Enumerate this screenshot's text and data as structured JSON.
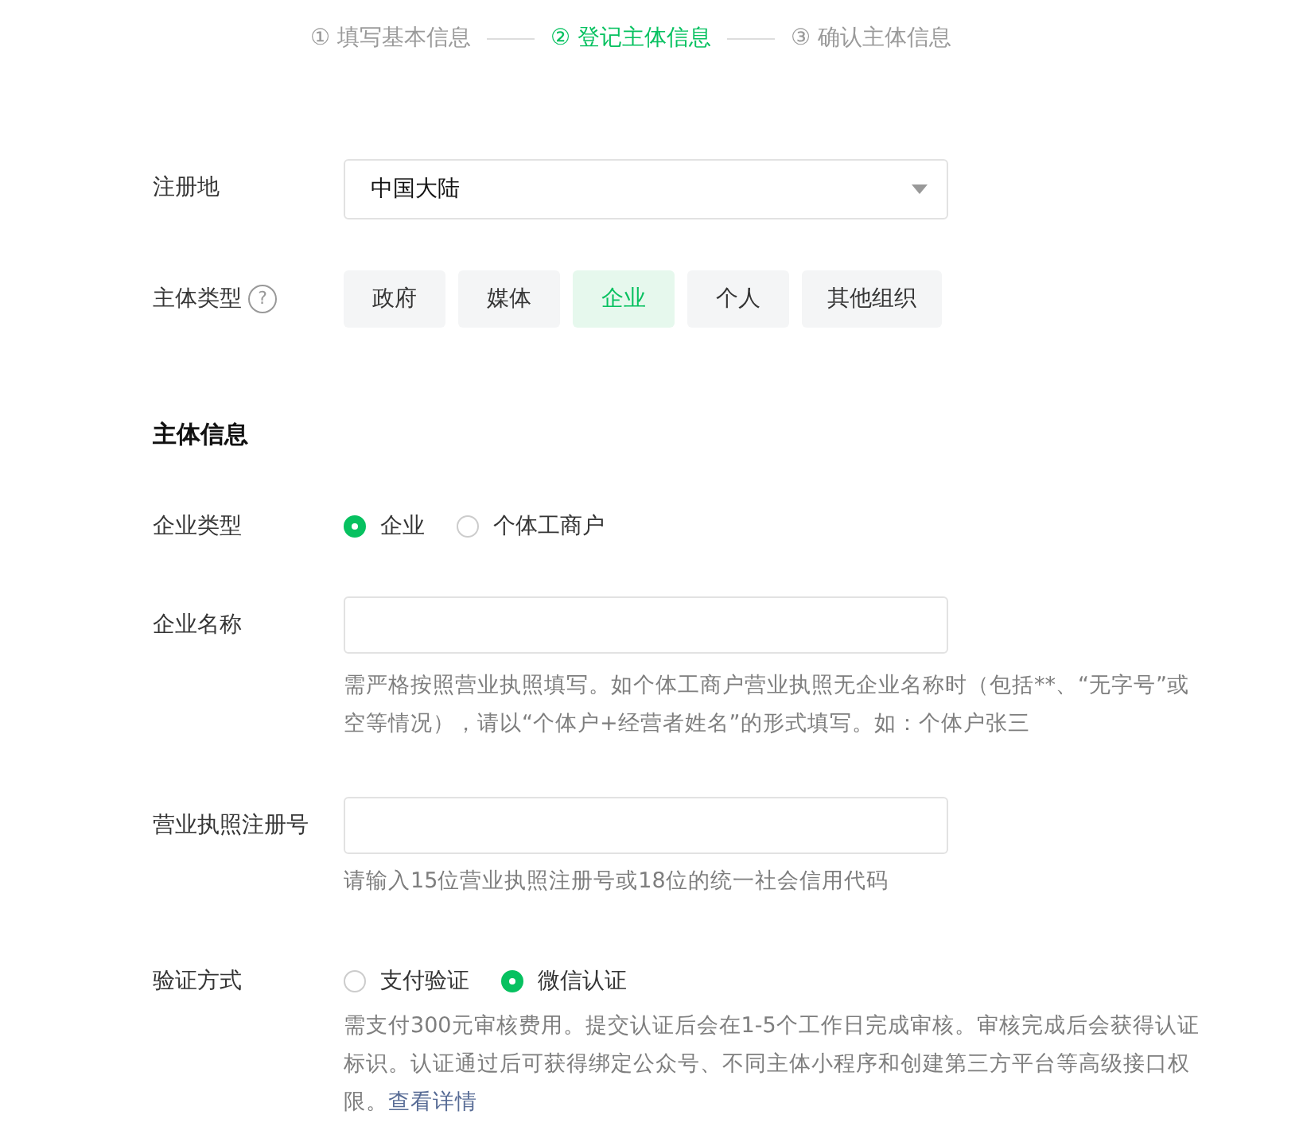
{
  "steps": [
    {
      "number": "①",
      "label": "填写基本信息",
      "selected": false
    },
    {
      "number": "②",
      "label": "登记主体信息",
      "selected": true
    },
    {
      "number": "③",
      "label": "确认主体信息",
      "selected": false
    }
  ],
  "region": {
    "label": "注册地",
    "value": "中国大陆"
  },
  "entity_type": {
    "label": "主体类型",
    "help": "?",
    "options": [
      {
        "label": "政府",
        "selected": false
      },
      {
        "label": "媒体",
        "selected": false
      },
      {
        "label": "企业",
        "selected": true
      },
      {
        "label": "个人",
        "selected": false
      },
      {
        "label": "其他组织",
        "selected": false
      }
    ]
  },
  "section_title": "主体信息",
  "company_type": {
    "label": "企业类型",
    "options": [
      {
        "label": "企业",
        "selected": true
      },
      {
        "label": "个体工商户",
        "selected": false
      }
    ]
  },
  "company_name": {
    "label": "企业名称",
    "hint": "需严格按照营业执照填写。如个体工商户营业执照无企业名称时（包括**、“无字号”或空等情况），请以“个体户+经营者姓名”的形式填写。如：个体户张三"
  },
  "license_number": {
    "label": "营业执照注册号",
    "hint": "请输入15位营业执照注册号或18位的统一社会信用代码"
  },
  "verification": {
    "label": "验证方式",
    "options": [
      {
        "label": "支付验证",
        "selected": false
      },
      {
        "label": "微信认证",
        "selected": true
      }
    ],
    "hint": "需支付300元审核费用。提交认证后会在1-5个工作日完成审核。审核完成后会获得认证标识。认证通过后可获得绑定公众号、不同主体小程序和创建第三方平台等高级接口权限。",
    "link": "查看详情"
  }
}
